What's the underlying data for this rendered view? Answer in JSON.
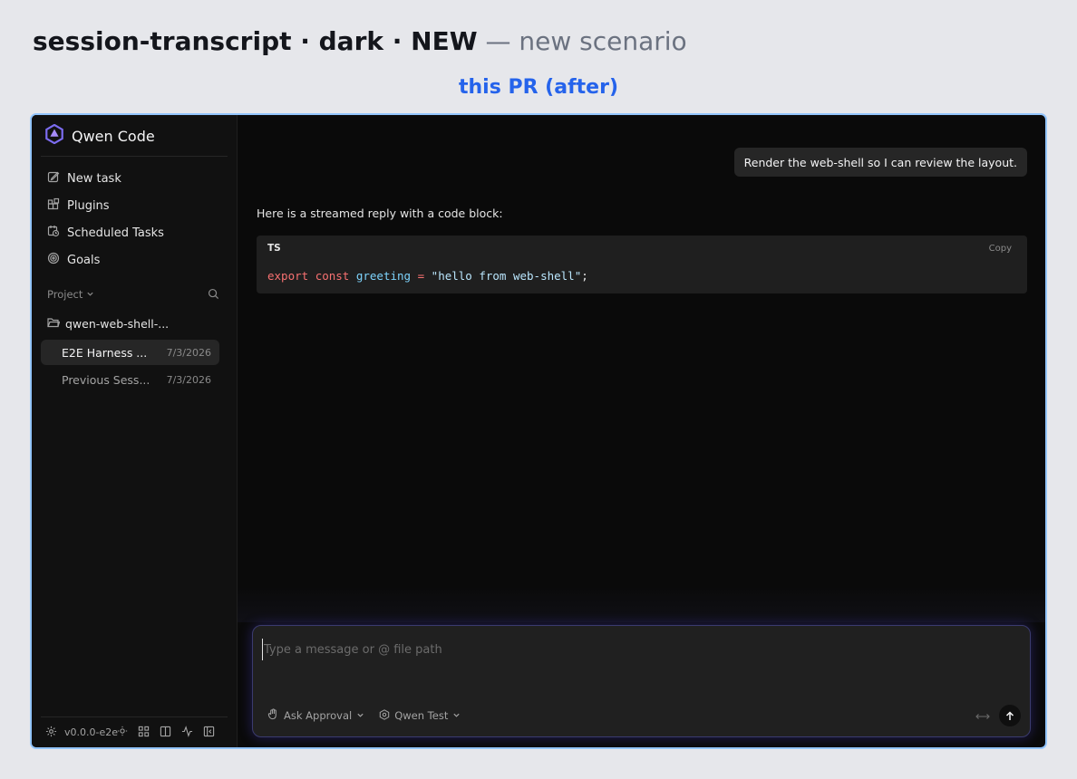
{
  "heading": {
    "title": "session-transcript · dark · NEW",
    "suffix": " — new scenario"
  },
  "subheading": "this PR (after)",
  "sidebar": {
    "brand": "Qwen Code",
    "nav": [
      {
        "label": "New task",
        "icon": "edit-icon"
      },
      {
        "label": "Plugins",
        "icon": "plugins-icon"
      },
      {
        "label": "Scheduled Tasks",
        "icon": "calendar-clock-icon"
      },
      {
        "label": "Goals",
        "icon": "target-icon"
      }
    ],
    "project_label": "Project",
    "folder": "qwen-web-shell-...",
    "sessions": [
      {
        "title": "E2E Harness ...",
        "date": "7/3/2026",
        "active": true
      },
      {
        "title": "Previous Sess...",
        "date": "7/3/2026",
        "active": false
      }
    ],
    "footer": {
      "version": "v0.0.0-e2e"
    }
  },
  "chat": {
    "user_message": "Render the web-shell so I can review the layout.",
    "assistant_text": "Here is a streamed reply with a code block:",
    "code": {
      "lang": "TS",
      "copy_label": "Copy",
      "tokens": {
        "kw1": "export",
        "kw2": "const",
        "ident": "greeting",
        "op": "=",
        "string": "\"hello from web-shell\"",
        "semi": ";"
      }
    }
  },
  "composer": {
    "placeholder": "Type a message or @ file path",
    "value": "",
    "approval_label": "Ask Approval",
    "model_label": "Qwen Test"
  },
  "colors": {
    "accent": "#2563eb",
    "frame_border": "#93c5fd",
    "brand_icon": "#7c6cf0"
  }
}
